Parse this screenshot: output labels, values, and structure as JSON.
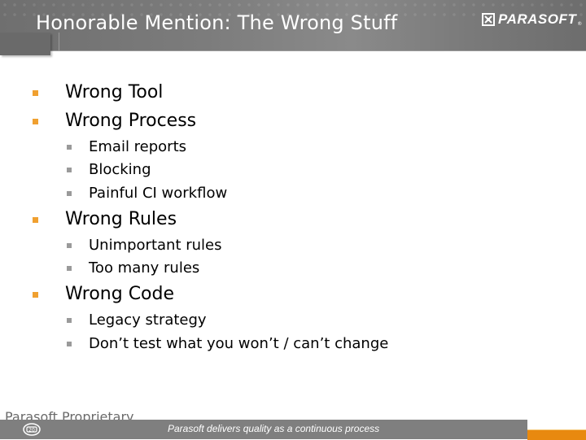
{
  "header": {
    "title": "Honorable Mention: The Wrong Stuff",
    "logo_text": "PARASOFT",
    "logo_tm": "®",
    "logo_icon": "parasoft-logo-icon"
  },
  "colors": {
    "header_gray": "#7c7c7c",
    "bullet_primary": "#f0a030",
    "bullet_secondary": "#9a9a9a",
    "footer_gray": "#7f7f7f",
    "accent_orange": "#e8890f"
  },
  "bullets": [
    {
      "label": "Wrong Tool",
      "children": []
    },
    {
      "label": "Wrong Process",
      "children": [
        "Email reports",
        "Blocking",
        "Painful CI workflow"
      ]
    },
    {
      "label": "Wrong Rules",
      "children": [
        "Unimportant rules",
        "Too many rules"
      ]
    },
    {
      "label": "Wrong Code",
      "children": [
        "Legacy strategy",
        "Don’t test what you won’t / can’t change"
      ]
    }
  ],
  "footer": {
    "label": "Parasoft Proprietary",
    "tagline": "Parasoft delivers quality as a continuous process",
    "icon": "20-year-badge-icon"
  }
}
